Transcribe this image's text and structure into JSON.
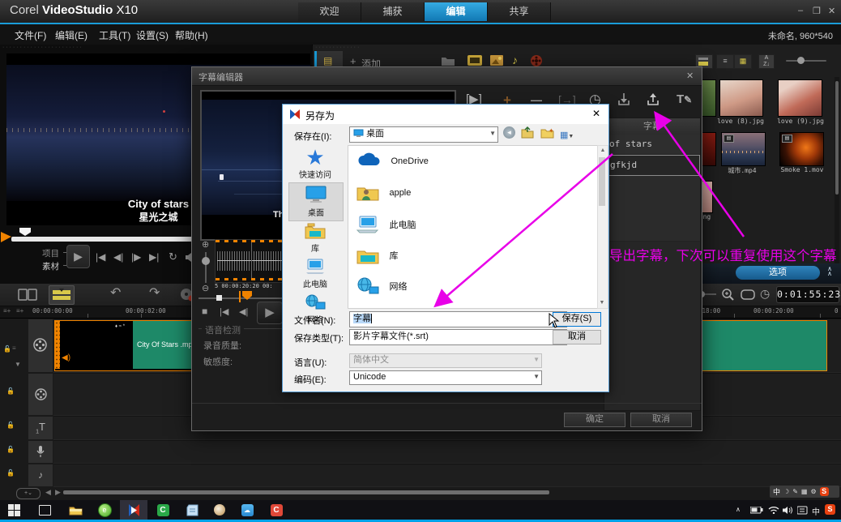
{
  "titlebar": {
    "app_title_1": "Corel",
    "app_title_2": "VideoStudio",
    "app_title_3": "X10",
    "tabs": [
      {
        "label": "欢迎"
      },
      {
        "label": "捕获"
      },
      {
        "label": "编辑",
        "active": true
      },
      {
        "label": "共享"
      }
    ]
  },
  "menubar": {
    "items": [
      {
        "label": "文件(F)"
      },
      {
        "label": "编辑(E)"
      },
      {
        "label": "工具(T)"
      },
      {
        "label": "设置(S)"
      },
      {
        "label": "帮助(H)"
      }
    ],
    "project_info": "未命名, 960*540"
  },
  "preview": {
    "subtitle_en": "City of stars",
    "subtitle_zh": "星光之城",
    "mode_project": "项目",
    "mode_clip": "素材"
  },
  "library": {
    "add_label": "添加",
    "options_label": "选项",
    "thumbs": [
      {
        "label": "love (8).jpg"
      },
      {
        "label": "love (9).jpg"
      },
      {
        "label": "城市.mp4"
      },
      {
        "label": "Smoke 1.mov"
      },
      {
        "label": "png"
      }
    ]
  },
  "subtitle_editor": {
    "title": "字幕编辑器",
    "panel_header": "字幕",
    "rows": [
      {
        "text": "of stars"
      },
      {
        "text": "gfkjd"
      }
    ],
    "preview_caption": "Th",
    "wave_ruler": "5  00:00:20:20  00:",
    "voice_detect": "语音检测",
    "record_quality": "录音质量:",
    "sensitivity": "敏感度:",
    "ok": "确定",
    "cancel": "取消"
  },
  "save_dialog": {
    "title": "另存为",
    "save_in_label": "保存在(I):",
    "save_in_value": "桌面",
    "sidebar": [
      {
        "label": "快速访问"
      },
      {
        "label": "桌面"
      },
      {
        "label": "库"
      },
      {
        "label": "此电脑"
      },
      {
        "label": "网络"
      }
    ],
    "files": [
      {
        "label": "OneDrive"
      },
      {
        "label": "apple"
      },
      {
        "label": "此电脑"
      },
      {
        "label": "库"
      },
      {
        "label": "网络"
      }
    ],
    "file_name_label": "文件名(N):",
    "file_name_value": "字幕",
    "file_type_label": "保存类型(T):",
    "file_type_value": "影片字幕文件(*.srt)",
    "language_label": "语言(U):",
    "language_value": "简体中文",
    "encoding_label": "编码(E):",
    "encoding_value": "Unicode",
    "save_button": "保存(S)",
    "cancel_button": "取消"
  },
  "annotation": {
    "text": "导出字幕，下次可以重复使用这个字幕",
    "color": "#e800e8"
  },
  "timeline": {
    "ruler": [
      {
        "label": "00:00:00:00"
      },
      {
        "label": "00:00:02:00"
      },
      {
        "label": ":18:00"
      },
      {
        "label": "00:00:20:00"
      },
      {
        "label": "0"
      }
    ],
    "clip_label": "City Of Stars .mp",
    "timecode": "0:01:55:23"
  },
  "taskbar": {
    "lang_indicator": "中",
    "sogou_s": "S",
    "camtasia_c": "C",
    "red_c": "C"
  },
  "icons": {
    "minimize": "–",
    "restore": "❐",
    "close": "✕",
    "plus": "+",
    "seg_play": "[▶]",
    "seg_del": "—",
    "seg_merge": "[→]",
    "clock": "◷",
    "text_t": "T",
    "pen": "✎",
    "stop": "■",
    "prev": "|◀",
    "step_back": "◀|",
    "step_fwd": "|▶",
    "next": "▶|",
    "repeat": "↻",
    "play": "▶",
    "zoom_in": "⊕",
    "zoom_out": "⊖",
    "undo": "↶",
    "redo": "↷",
    "chevron_up": "∧",
    "scroll_left": "◀",
    "scroll_right": "▶",
    "moon": "☽",
    "grid": "▦",
    "gear": "⚙"
  },
  "colors": {
    "accent_blue": "#1a9cd8",
    "clip_teal": "#1e8968",
    "marker_orange": "#f08300",
    "annotation_magenta": "#e800e8"
  }
}
